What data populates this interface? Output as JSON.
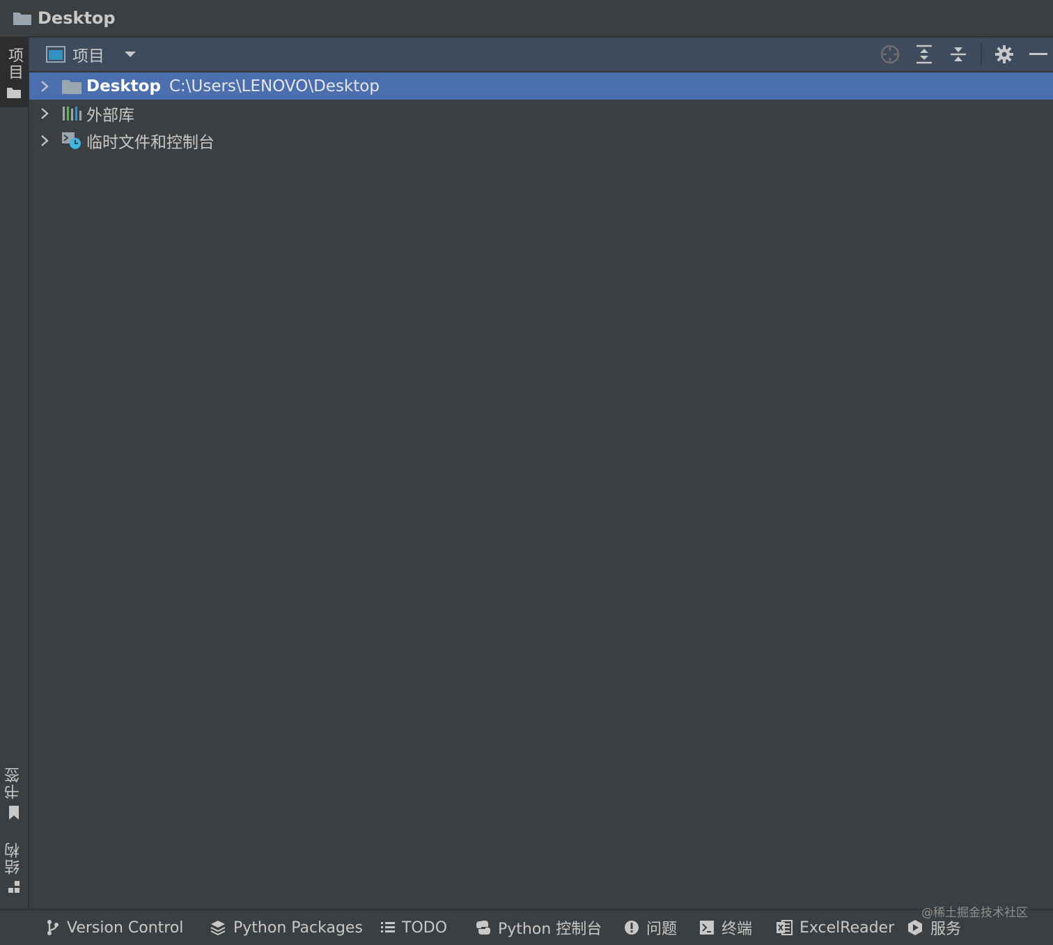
{
  "window": {
    "title": "Desktop"
  },
  "left_strip": {
    "project_tab": "项目",
    "bookmarks_tab": "书签",
    "structure_tab": "结构"
  },
  "panel": {
    "view_label": "项目"
  },
  "tree": [
    {
      "name": "Desktop",
      "path": "C:\\Users\\LENOVO\\Desktop"
    },
    {
      "name": "外部库"
    },
    {
      "name": "临时文件和控制台"
    }
  ],
  "bottom_tabs": [
    {
      "label": "Version Control"
    },
    {
      "label": "Python Packages"
    },
    {
      "label": "TODO"
    },
    {
      "label": "Python 控制台"
    },
    {
      "label": "问题"
    },
    {
      "label": "终端"
    },
    {
      "label": "ExcelReader"
    },
    {
      "label": "服务"
    }
  ],
  "watermark": "@稀土掘金技术社区",
  "colors": {
    "selection": "#4b6eaf",
    "panel_header": "#3d4b5c",
    "background": "#3c3f41"
  }
}
